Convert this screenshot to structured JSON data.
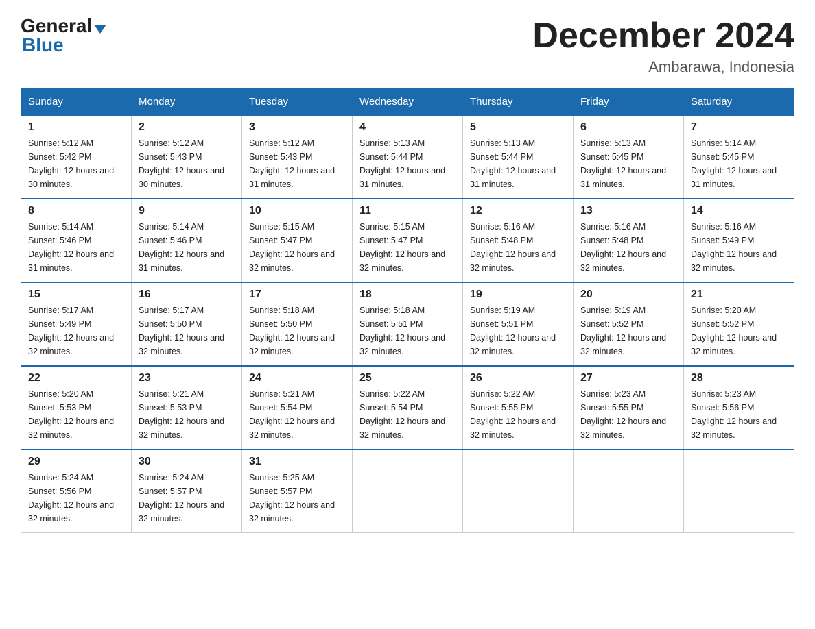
{
  "header": {
    "logo_general": "General",
    "logo_blue": "Blue",
    "month_year": "December 2024",
    "location": "Ambarawa, Indonesia"
  },
  "days_of_week": [
    "Sunday",
    "Monday",
    "Tuesday",
    "Wednesday",
    "Thursday",
    "Friday",
    "Saturday"
  ],
  "weeks": [
    [
      {
        "day": "1",
        "sunrise": "5:12 AM",
        "sunset": "5:42 PM",
        "daylight": "12 hours and 30 minutes."
      },
      {
        "day": "2",
        "sunrise": "5:12 AM",
        "sunset": "5:43 PM",
        "daylight": "12 hours and 30 minutes."
      },
      {
        "day": "3",
        "sunrise": "5:12 AM",
        "sunset": "5:43 PM",
        "daylight": "12 hours and 31 minutes."
      },
      {
        "day": "4",
        "sunrise": "5:13 AM",
        "sunset": "5:44 PM",
        "daylight": "12 hours and 31 minutes."
      },
      {
        "day": "5",
        "sunrise": "5:13 AM",
        "sunset": "5:44 PM",
        "daylight": "12 hours and 31 minutes."
      },
      {
        "day": "6",
        "sunrise": "5:13 AM",
        "sunset": "5:45 PM",
        "daylight": "12 hours and 31 minutes."
      },
      {
        "day": "7",
        "sunrise": "5:14 AM",
        "sunset": "5:45 PM",
        "daylight": "12 hours and 31 minutes."
      }
    ],
    [
      {
        "day": "8",
        "sunrise": "5:14 AM",
        "sunset": "5:46 PM",
        "daylight": "12 hours and 31 minutes."
      },
      {
        "day": "9",
        "sunrise": "5:14 AM",
        "sunset": "5:46 PM",
        "daylight": "12 hours and 31 minutes."
      },
      {
        "day": "10",
        "sunrise": "5:15 AM",
        "sunset": "5:47 PM",
        "daylight": "12 hours and 32 minutes."
      },
      {
        "day": "11",
        "sunrise": "5:15 AM",
        "sunset": "5:47 PM",
        "daylight": "12 hours and 32 minutes."
      },
      {
        "day": "12",
        "sunrise": "5:16 AM",
        "sunset": "5:48 PM",
        "daylight": "12 hours and 32 minutes."
      },
      {
        "day": "13",
        "sunrise": "5:16 AM",
        "sunset": "5:48 PM",
        "daylight": "12 hours and 32 minutes."
      },
      {
        "day": "14",
        "sunrise": "5:16 AM",
        "sunset": "5:49 PM",
        "daylight": "12 hours and 32 minutes."
      }
    ],
    [
      {
        "day": "15",
        "sunrise": "5:17 AM",
        "sunset": "5:49 PM",
        "daylight": "12 hours and 32 minutes."
      },
      {
        "day": "16",
        "sunrise": "5:17 AM",
        "sunset": "5:50 PM",
        "daylight": "12 hours and 32 minutes."
      },
      {
        "day": "17",
        "sunrise": "5:18 AM",
        "sunset": "5:50 PM",
        "daylight": "12 hours and 32 minutes."
      },
      {
        "day": "18",
        "sunrise": "5:18 AM",
        "sunset": "5:51 PM",
        "daylight": "12 hours and 32 minutes."
      },
      {
        "day": "19",
        "sunrise": "5:19 AM",
        "sunset": "5:51 PM",
        "daylight": "12 hours and 32 minutes."
      },
      {
        "day": "20",
        "sunrise": "5:19 AM",
        "sunset": "5:52 PM",
        "daylight": "12 hours and 32 minutes."
      },
      {
        "day": "21",
        "sunrise": "5:20 AM",
        "sunset": "5:52 PM",
        "daylight": "12 hours and 32 minutes."
      }
    ],
    [
      {
        "day": "22",
        "sunrise": "5:20 AM",
        "sunset": "5:53 PM",
        "daylight": "12 hours and 32 minutes."
      },
      {
        "day": "23",
        "sunrise": "5:21 AM",
        "sunset": "5:53 PM",
        "daylight": "12 hours and 32 minutes."
      },
      {
        "day": "24",
        "sunrise": "5:21 AM",
        "sunset": "5:54 PM",
        "daylight": "12 hours and 32 minutes."
      },
      {
        "day": "25",
        "sunrise": "5:22 AM",
        "sunset": "5:54 PM",
        "daylight": "12 hours and 32 minutes."
      },
      {
        "day": "26",
        "sunrise": "5:22 AM",
        "sunset": "5:55 PM",
        "daylight": "12 hours and 32 minutes."
      },
      {
        "day": "27",
        "sunrise": "5:23 AM",
        "sunset": "5:55 PM",
        "daylight": "12 hours and 32 minutes."
      },
      {
        "day": "28",
        "sunrise": "5:23 AM",
        "sunset": "5:56 PM",
        "daylight": "12 hours and 32 minutes."
      }
    ],
    [
      {
        "day": "29",
        "sunrise": "5:24 AM",
        "sunset": "5:56 PM",
        "daylight": "12 hours and 32 minutes."
      },
      {
        "day": "30",
        "sunrise": "5:24 AM",
        "sunset": "5:57 PM",
        "daylight": "12 hours and 32 minutes."
      },
      {
        "day": "31",
        "sunrise": "5:25 AM",
        "sunset": "5:57 PM",
        "daylight": "12 hours and 32 minutes."
      },
      null,
      null,
      null,
      null
    ]
  ]
}
